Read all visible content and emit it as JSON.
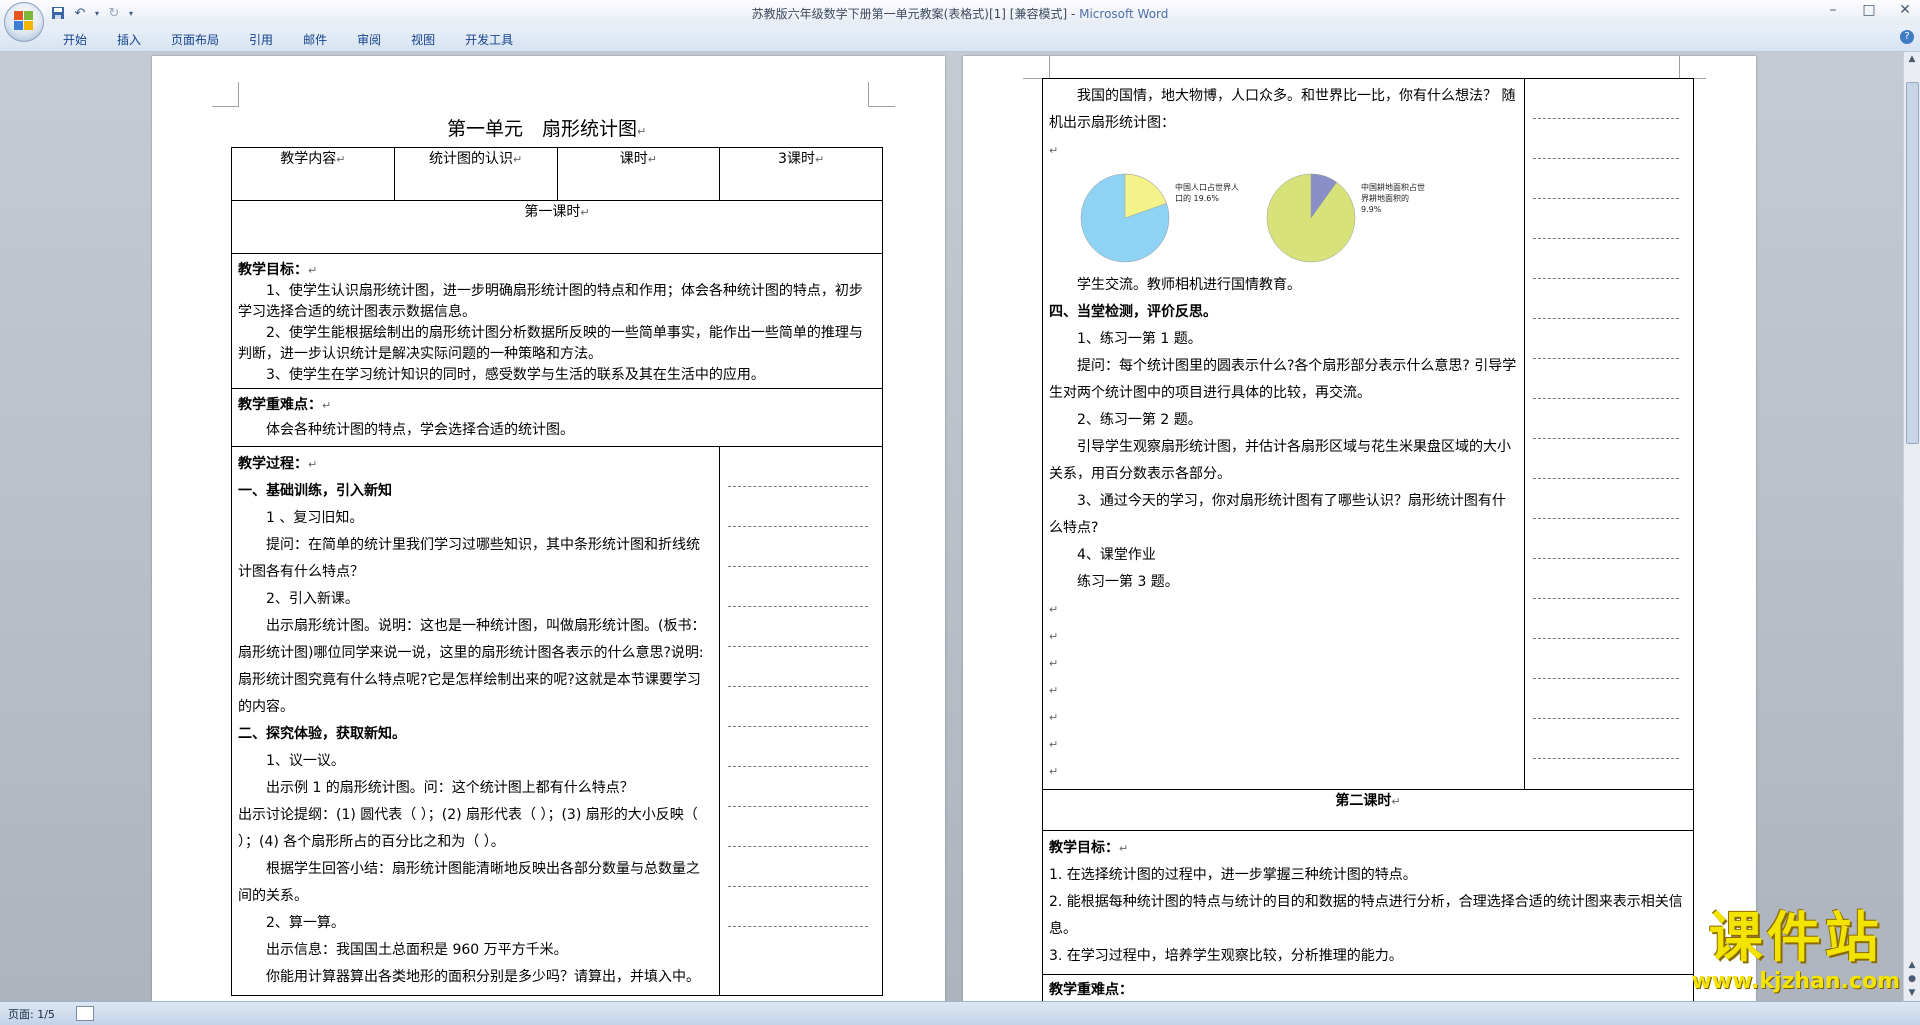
{
  "window": {
    "title": "苏教版六年级数学下册第一单元教案(表格式)[1] [兼容模式]",
    "app_name": "Microsoft Word",
    "separator": " - "
  },
  "ribbon": {
    "tabs": [
      "开始",
      "插入",
      "页面布局",
      "引用",
      "邮件",
      "审阅",
      "视图",
      "开发工具"
    ]
  },
  "page1": {
    "doc_title": "第一单元　扇形统计图",
    "header_row": [
      "教学内容",
      "统计图的认识",
      "课时",
      "3课时"
    ],
    "lesson_title": "第一课时",
    "goals_label": "教学目标：",
    "goals": [
      "1、使学生认识扇形统计图，进一步明确扇形统计图的特点和作用；体会各种统计图的特点，初步学习选择合适的统计图表示数据信息。",
      "2、使学生能根据绘制出的扇形统计图分析数据所反映的一些简单事实，能作出一些简单的推理与判断，进一步认识统计是解决实际问题的一种策略和方法。",
      "3、使学生在学习统计知识的同时，感受数学与生活的联系及其在生活中的应用。"
    ],
    "keypoints_label": "教学重难点：",
    "keypoints_text": "体会各种统计图的特点，学会选择合适的统计图。",
    "process_label": "教学过程：",
    "process": [
      {
        "text": "一、基础训练，引入新知",
        "bold": true,
        "indent": false
      },
      {
        "text": "1 、复习旧知。",
        "bold": false,
        "indent": true
      },
      {
        "text": "提问：在简单的统计里我们学习过哪些知识，其中条形统计图和折线统计图各有什么特点？",
        "bold": false,
        "indent": true
      },
      {
        "text": "2、引入新课。",
        "bold": false,
        "indent": true
      },
      {
        "text": "出示扇形统计图。说明：这也是一种统计图，叫做扇形统计图。(板书：扇形统计图)哪位同学来说一说，这里的扇形统计图各表示的什么意思?说明:扇形统计图究竟有什么特点呢?它是怎样绘制出来的呢?这就是本节课要学习的内容。",
        "bold": false,
        "indent": true
      },
      {
        "text": "二、探究体验，获取新知。",
        "bold": true,
        "indent": false
      },
      {
        "text": "1、议一议。",
        "bold": false,
        "indent": true
      },
      {
        "text": "出示例 1 的扇形统计图。问：这个统计图上都有什么特点？",
        "bold": false,
        "indent": true
      },
      {
        "text": "出示讨论提纲：(1) 圆代表（ ）；(2) 扇形代表（ ）；(3) 扇形的大小反映（ ）；(4) 各个扇形所占的百分比之和为（ ）。",
        "bold": false,
        "indent": false
      },
      {
        "text": "根据学生回答小结：扇形统计图能清晰地反映出各部分数量与总数量之间的关系。",
        "bold": false,
        "indent": true
      },
      {
        "text": "2、算一算。",
        "bold": false,
        "indent": true
      },
      {
        "text": "出示信息：我国国土总面积是 960 万平方千米。",
        "bold": false,
        "indent": true
      },
      {
        "text": "你能用计算器算出各类地形的面积分别是多少吗？请算出，并填入中。",
        "bold": false,
        "indent": true
      }
    ]
  },
  "page2": {
    "intro": [
      "我国的国情，地大物博，人口众多。和世界比一比，你有什么想法？ 随机出示扇形统计图："
    ],
    "pie1_label": "中国人口占世界人口的 19.6%",
    "pie1_value": 19.6,
    "pie2_label": "中国耕地面积占世界耕地面积的 9.9%",
    "pie2_value": 9.9,
    "colors": {
      "pie1": "#8fd3f4",
      "pie1_slice": "#f3f38a",
      "pie2": "#d7e27a",
      "pie2_slice": "#8a8fc8"
    },
    "after": [
      {
        "text": "学生交流。教师相机进行国情教育。",
        "bold": false,
        "indent": true
      },
      {
        "text": "四、当堂检测，评价反思。",
        "bold": true,
        "indent": false
      },
      {
        "text": "1、练习一第 1 题。",
        "bold": false,
        "indent": true
      },
      {
        "text": "提问：每个统计图里的圆表示什么?各个扇形部分表示什么意思? 引导学生对两个统计图中的项目进行具体的比较，再交流。",
        "bold": false,
        "indent": true
      },
      {
        "text": "2、练习一第 2 题。",
        "bold": false,
        "indent": true
      },
      {
        "text": "引导学生观察扇形统计图，并估计各扇形区域与花生米果盘区域的大小关系，用百分数表示各部分。",
        "bold": false,
        "indent": true
      },
      {
        "text": "3、通过今天的学习，你对扇形统计图有了哪些认识？扇形统计图有什么特点?",
        "bold": false,
        "indent": true
      },
      {
        "text": "4、课堂作业",
        "bold": false,
        "indent": true
      },
      {
        "text": "练习一第 3 题。",
        "bold": false,
        "indent": true
      }
    ],
    "lesson2_title": "第二课时",
    "goals_label": "教学目标：",
    "goals": [
      "1. 在选择统计图的过程中，进一步掌握三种统计图的特点。",
      "2. 能根据每种统计图的特点与统计的目的和数据的特点进行分析，合理选择合适的统计图来表示相关信息。",
      "3. 在学习过程中，培养学生观察比较，分析推理的能力。"
    ],
    "keypoints_label": "教学重难点："
  },
  "statusbar": {
    "page_indicator": "页面: 1/5"
  },
  "watermark": {
    "brand": "课件站",
    "url": "www.kjzhan.com"
  }
}
